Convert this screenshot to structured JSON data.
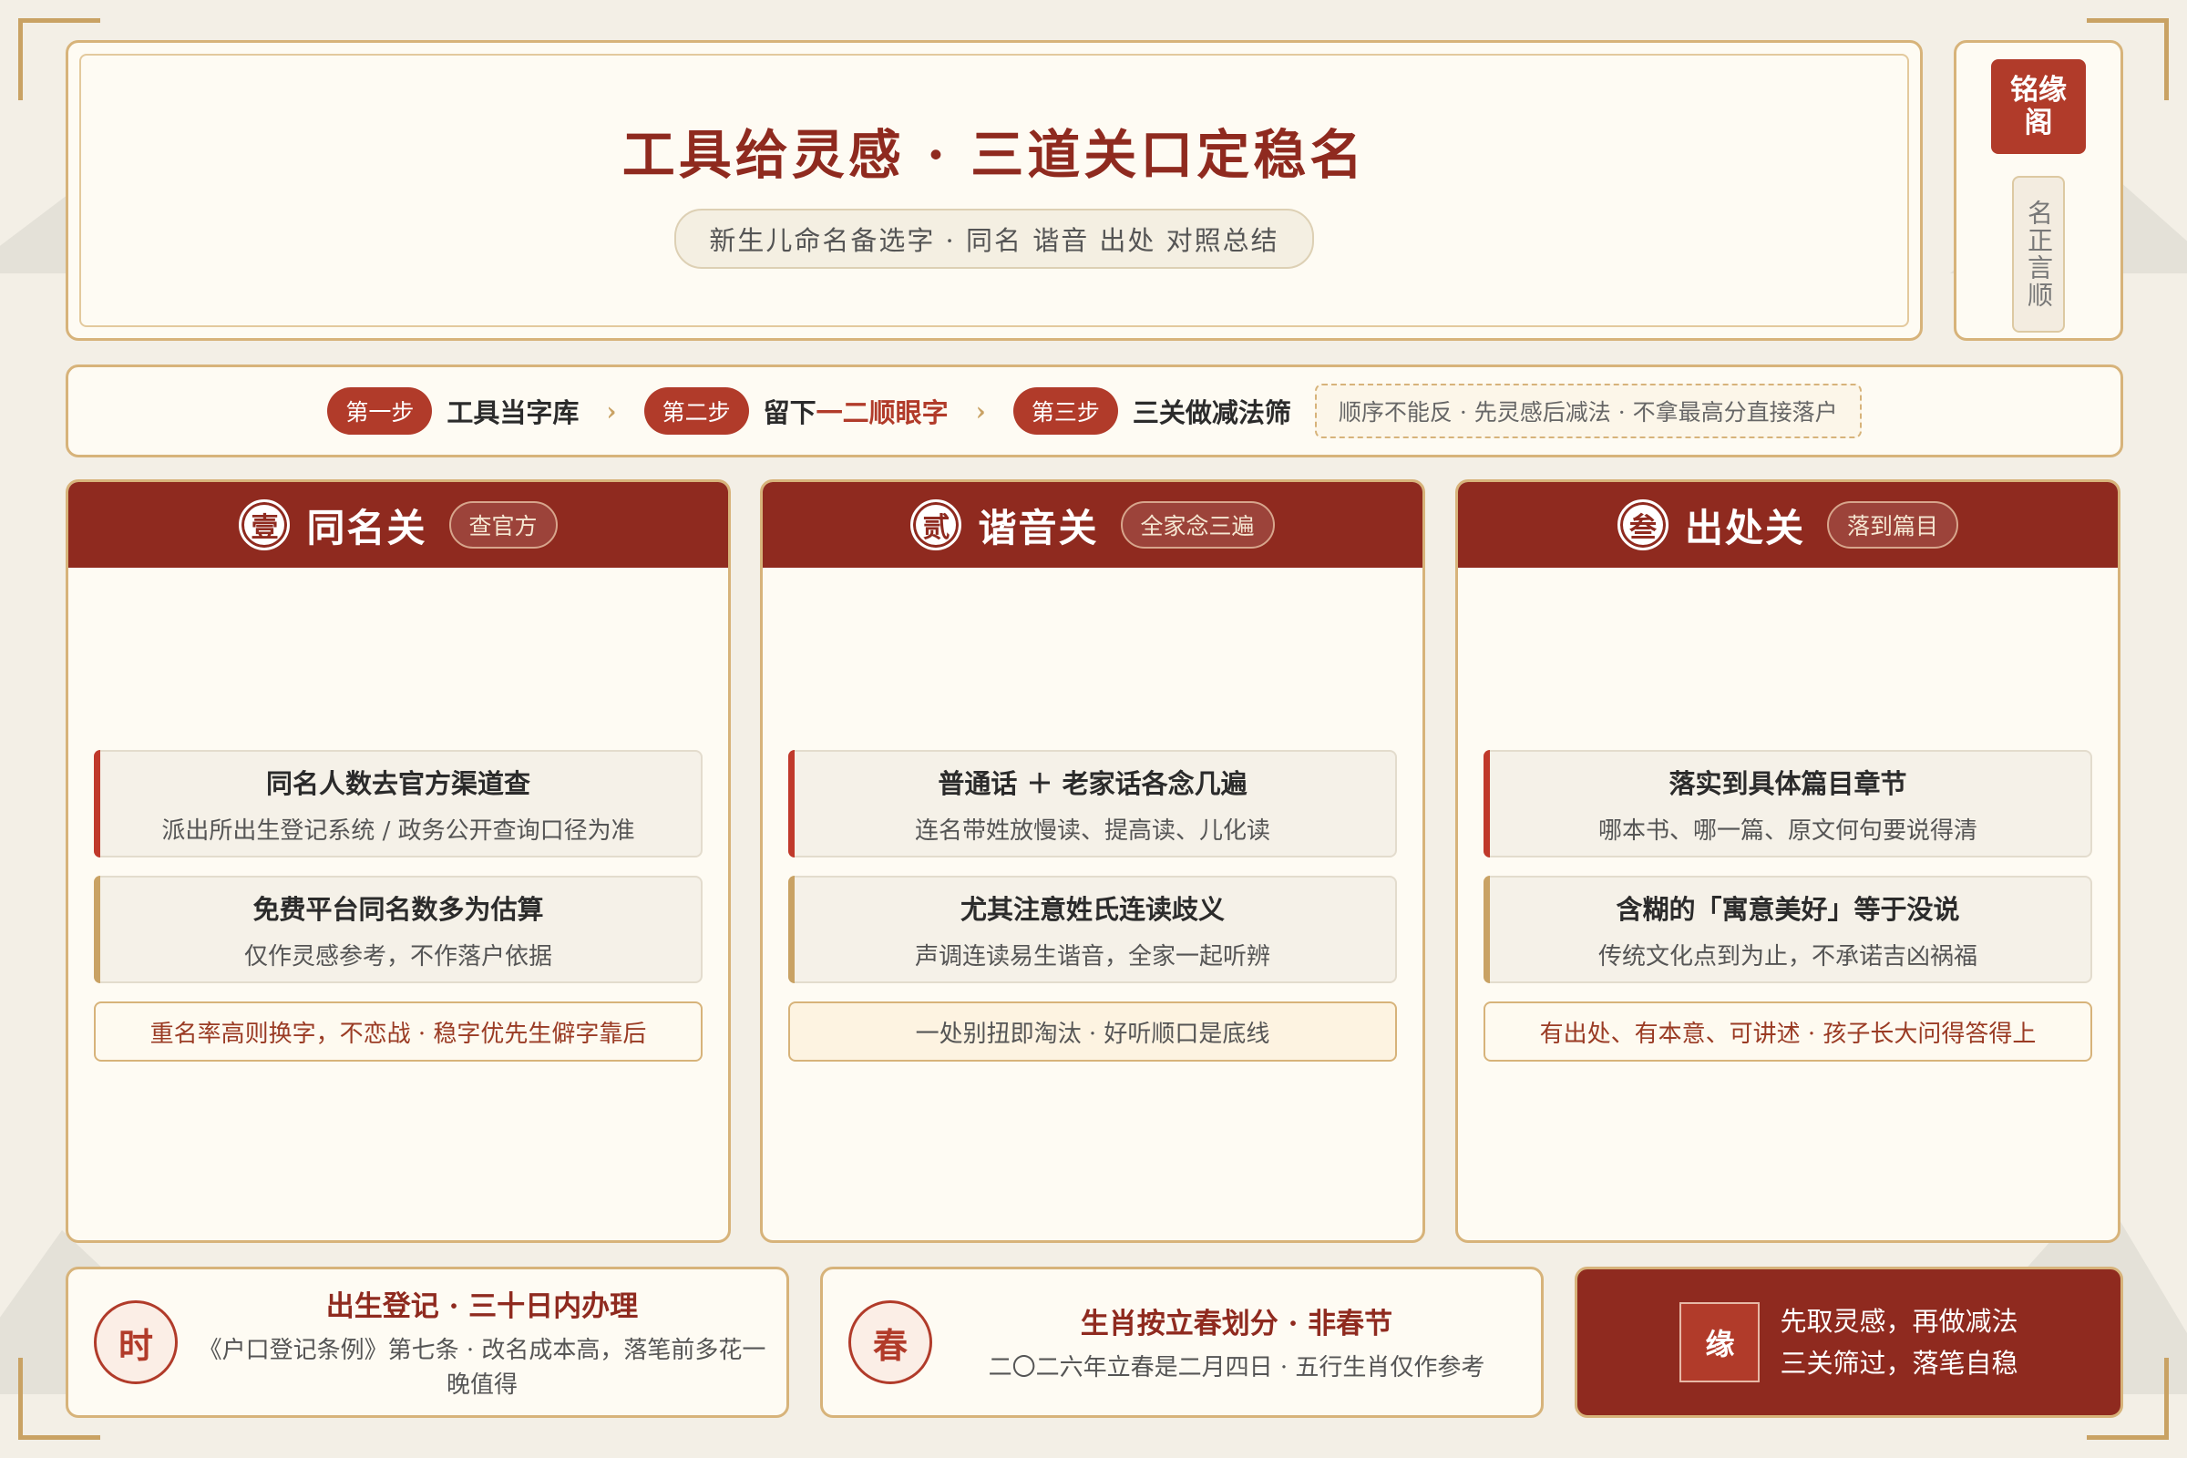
{
  "header": {
    "title": "工具给灵感 · 三道关口定稳名",
    "subtitle": "新生儿命名备选字 · 同名 谐音 出处 对照总结"
  },
  "seal": {
    "name": "铭缘阁",
    "motto": "名正言顺"
  },
  "steps": {
    "items": [
      {
        "pill": "第一步",
        "text": "工具当字库"
      },
      {
        "pill": "第二步",
        "text_prefix": "留下",
        "text_highlight": "一二顺眼字"
      },
      {
        "pill": "第三步",
        "text": "三关做减法筛"
      }
    ],
    "note": "顺序不能反 · 先灵感后减法 · 不拿最高分直接落户"
  },
  "gates": [
    {
      "num": "壹",
      "title": "同名关",
      "tag": "查官方",
      "items": [
        {
          "title": "同名人数去官方渠道查",
          "desc": "派出所出生登记系统 / 政务公开查询口径为准"
        },
        {
          "title": "免费平台同名数多为估算",
          "desc": "仅作灵感参考，不作落户依据"
        }
      ],
      "note": "重名率高则换字，不恋战 · 稳字优先生僻字靠后"
    },
    {
      "num": "贰",
      "title": "谐音关",
      "tag": "全家念三遍",
      "items": [
        {
          "title": "普通话 ＋ 老家话各念几遍",
          "desc": "连名带姓放慢读、提高读、儿化读"
        },
        {
          "title": "尤其注意姓氏连读歧义",
          "desc": "声调连读易生谐音，全家一起听辨"
        }
      ],
      "note": "一处别扭即淘汰 · 好听顺口是底线"
    },
    {
      "num": "叁",
      "title": "出处关",
      "tag": "落到篇目",
      "items": [
        {
          "title": "落实到具体篇目章节",
          "desc": "哪本书、哪一篇、原文何句要说得清"
        },
        {
          "title": "含糊的「寓意美好」等于没说",
          "desc": "传统文化点到为止，不承诺吉凶祸福"
        }
      ],
      "note": "有出处、有本意、可讲述 · 孩子长大问得答得上"
    }
  ],
  "bottom": {
    "registration": {
      "icon_char": "时",
      "title": "出生登记 · 三十日内办理",
      "desc": "《户口登记条例》第七条 · 改名成本高，落笔前多花一晚值得"
    },
    "zodiac": {
      "icon_char": "春",
      "title": "生肖按立春划分 · 非春节",
      "desc": "二〇二六年立春是二月四日 · 五行生肖仅作参考"
    },
    "final": {
      "icon_char": "缘",
      "line1": "先取灵感，再做减法",
      "line2": "三关筛过，落笔自稳"
    }
  },
  "colors": {
    "primary_red": "#8f2a1f",
    "accent_red": "#b13b2a",
    "gold": "#c9a264",
    "background": "#f3efe6",
    "card": "#fefbf3"
  }
}
